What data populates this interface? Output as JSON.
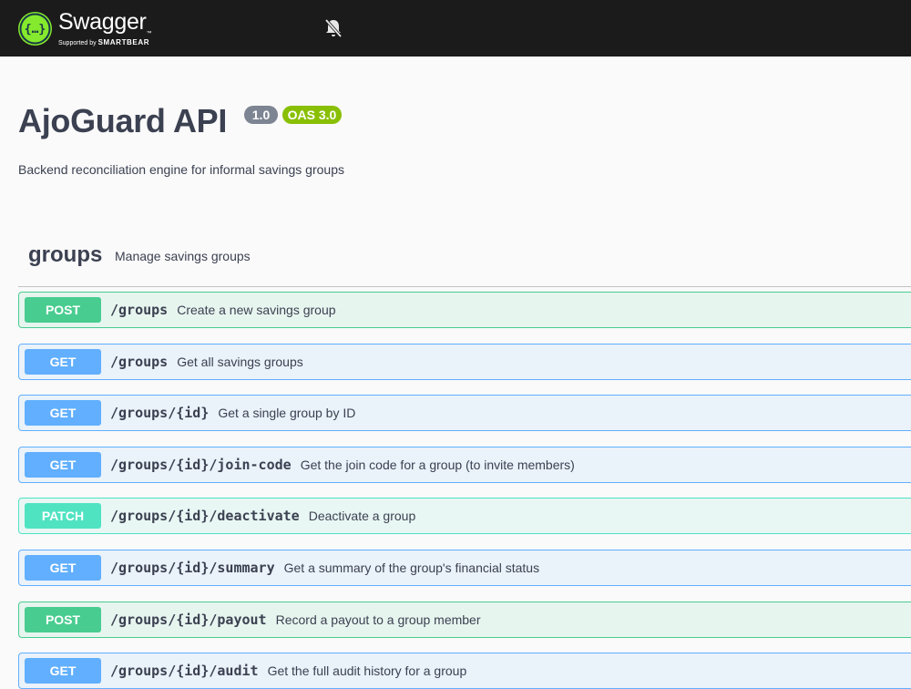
{
  "topbar": {
    "logo_title": "Swagger",
    "logo_tm": "™",
    "logo_supported": "Supported by",
    "logo_company": "SMARTBEAR",
    "logo_mark_text": "{…}"
  },
  "info": {
    "title": "AjoGuard API",
    "version": "1.0",
    "oas": "OAS 3.0",
    "description": "Backend reconciliation engine for informal savings groups"
  },
  "tag": {
    "name": "groups",
    "description": "Manage savings groups"
  },
  "operations": [
    {
      "method": "POST",
      "path": "/groups",
      "summary": "Create a new savings group"
    },
    {
      "method": "GET",
      "path": "/groups",
      "summary": "Get all savings groups"
    },
    {
      "method": "GET",
      "path": "/groups/{id}",
      "summary": "Get a single group by ID"
    },
    {
      "method": "GET",
      "path": "/groups/{id}/join-code",
      "summary": "Get the join code for a group (to invite members)"
    },
    {
      "method": "PATCH",
      "path": "/groups/{id}/deactivate",
      "summary": "Deactivate a group"
    },
    {
      "method": "GET",
      "path": "/groups/{id}/summary",
      "summary": "Get a summary of the group's financial status"
    },
    {
      "method": "POST",
      "path": "/groups/{id}/payout",
      "summary": "Record a payout to a group member"
    },
    {
      "method": "GET",
      "path": "/groups/{id}/audit",
      "summary": "Get the full audit history for a group"
    }
  ],
  "colors": {
    "topbar": "#1b1b1b",
    "logo_green": "#85ea2d",
    "post": "#49cc90",
    "get": "#61affe",
    "patch": "#50e3c2",
    "version_badge": "#7d8492",
    "oas_badge": "#89bf04"
  },
  "icons": {
    "logo": "swagger-logo-icon",
    "bell": "bell-slash-icon"
  }
}
